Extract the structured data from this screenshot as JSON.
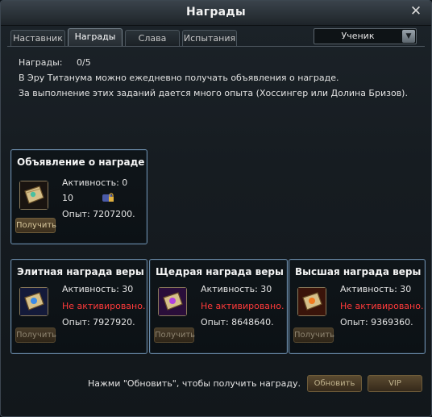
{
  "window": {
    "title": "Награды"
  },
  "tabs": [
    {
      "label": "Наставник"
    },
    {
      "label": "Награды"
    },
    {
      "label": "Слава"
    },
    {
      "label": "Испытания"
    }
  ],
  "dropdown": {
    "value": "Ученик"
  },
  "info": {
    "rewards_label": "Награды:",
    "rewards_value": "0/5",
    "line1": "В Эру Титанума можно ежедневно получать объявления о награде.",
    "line2": "За выполнение этих заданий дается много опыта (Хоссингер или Долина Бризов)."
  },
  "announcement": {
    "title": "Объявление о награде",
    "activity": "Активность: 0",
    "count": "10",
    "exp": "Опыт: 7207200.",
    "button": "Получить"
  },
  "faith": [
    {
      "title": "Элитная награда веры",
      "activity": "Активность: 30",
      "status": "Не активировано.",
      "exp": "Опыт: 7927920.",
      "button": "Получить",
      "icon": "blue-gem-scroll-icon"
    },
    {
      "title": "Щедрая награда веры",
      "activity": "Активность: 30",
      "status": "Не активировано.",
      "exp": "Опыт: 8648640.",
      "button": "Получить",
      "icon": "purple-gem-scroll-icon"
    },
    {
      "title": "Высшая награда веры",
      "activity": "Активность: 30",
      "status": "Не активировано.",
      "exp": "Опыт: 9369360.",
      "button": "Получить",
      "icon": "orange-gem-scroll-icon"
    }
  ],
  "footer": {
    "hint": "Нажми \"Обновить\", чтобы получить награду.",
    "refresh": "Обновить",
    "vip": "VIP"
  },
  "colors": {
    "panel_border": "#6a8aa8",
    "status_red": "#ff3a3a",
    "button_gold": "#d8c89c"
  }
}
